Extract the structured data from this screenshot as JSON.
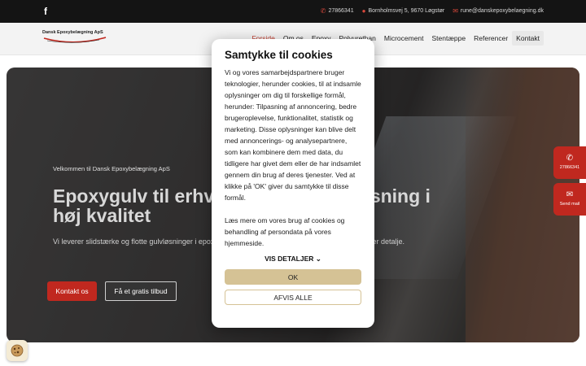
{
  "topbar": {
    "facebook_icon": "facebook-icon",
    "phone": "27866341",
    "address": "Bornholmsvej 5, 9670 Løgstør",
    "email": "rune@danskepoxybelaegning.dk"
  },
  "header": {
    "logo_text": "Dansk Epoxybelægning ApS",
    "nav": [
      "Forside",
      "Om os",
      "Epoxy",
      "Polyurethan",
      "Microcement",
      "Stentæppe",
      "Referencer",
      "Kontakt"
    ]
  },
  "hero": {
    "welcome": "Velkommen til Dansk Epoxybelægning ApS",
    "title": "Epoxygulv til erhverv og private - løsning i høj kvalitet",
    "subtitle": "Vi leverer slidstærke og flotte gulvløsninger i epoxy til erhverv og private, med fokus på kvalitet i hver detalje.",
    "cta_primary": "Kontakt os",
    "cta_secondary": "Få et gratis tilbud"
  },
  "floating": {
    "phone_label": "27866341",
    "mail_label": "Send mail"
  },
  "cookie_modal": {
    "title": "Samtykke til cookies",
    "body": "Vi og vores samarbejdspartnere bruger teknologier, herunder cookies, til at indsamle oplysninger om dig til forskellige formål, herunder: Tilpasning af annoncering, bedre brugeroplevelse, funktionalitet, statistik og marketing. Disse oplysninger kan blive delt med annoncerings- og analysepartnere, som kan kombinere dem med data, du tidligere har givet dem eller de har indsamlet gennem din brug af deres tjenester. Ved at klikke på 'OK' giver du samtykke til disse formål.",
    "body2": "Læs mere om vores brug af cookies og behandling af persondata på vores hjemmeside.",
    "details_label": "VIS DETALJER",
    "ok_label": "OK",
    "deny_label": "AFVIS ALLE"
  },
  "colors": {
    "accent": "#c0281f",
    "cookie_button": "#d5c295",
    "topbar": "#141414"
  }
}
